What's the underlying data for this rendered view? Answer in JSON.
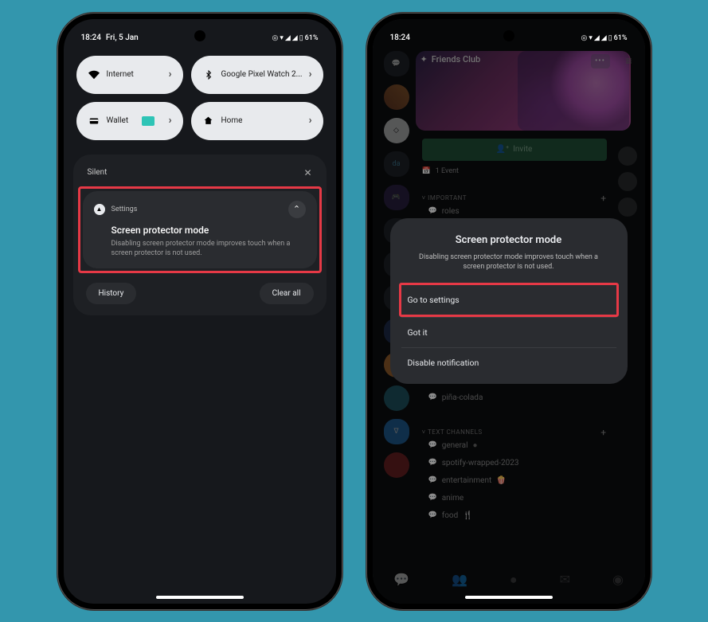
{
  "status": {
    "time": "18:24",
    "date": "Fri, 5 Jan",
    "battery": "61%"
  },
  "qs": {
    "internet": "Internet",
    "watch": "Google Pixel Watch 2...",
    "wallet": "Wallet",
    "home": "Home"
  },
  "notif": {
    "section": "Silent",
    "app": "Settings",
    "title": "Screen protector mode",
    "body": "Disabling screen protector mode improves touch when a screen protector is not used.",
    "history": "History",
    "clearall": "Clear all"
  },
  "discord": {
    "server": "Friends Club",
    "invite": "Invite",
    "event": "1 Event",
    "sec_important": "IMPORTANT",
    "ch_roles": "roles",
    "sec_text": "TEXT CHANNELS",
    "ch_general": "general",
    "ch_spotify": "spotify-wrapped-2023",
    "ch_pina": "piña-colada",
    "ch_ent": "entertainment",
    "ch_anime": "anime",
    "ch_food": "food",
    "server_abbr_da": "da"
  },
  "dialog": {
    "title": "Screen protector mode",
    "body": "Disabling screen protector mode improves touch when a screen protector is not used.",
    "opt1": "Go to settings",
    "opt2": "Got it",
    "opt3": "Disable notification"
  }
}
